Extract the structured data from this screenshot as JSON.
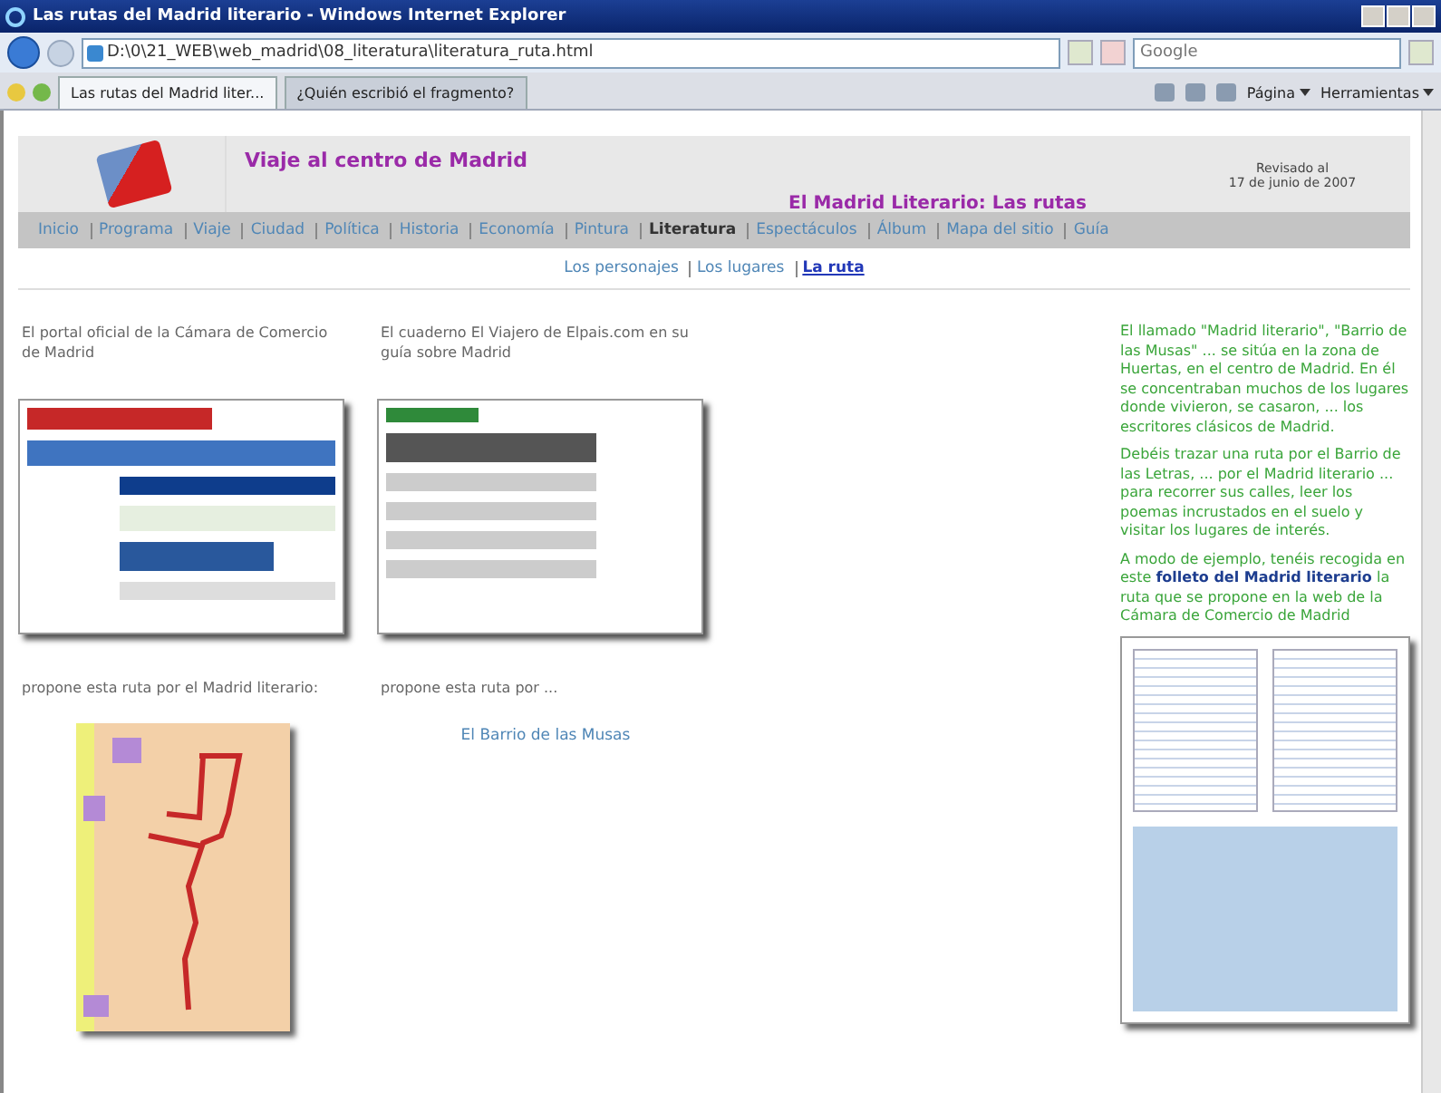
{
  "window": {
    "title": "Las rutas del Madrid literario - Windows Internet Explorer"
  },
  "address_bar": {
    "value": "D:\\0\\21_WEB\\web_madrid\\08_literatura\\literatura_ruta.html"
  },
  "search": {
    "placeholder": "Google"
  },
  "tabs": [
    {
      "label": "Las rutas del Madrid liter...",
      "selected": true
    },
    {
      "label": "¿Quién escribió el fragmento?",
      "selected": false
    }
  ],
  "toolbar": [
    "Página",
    "Herramientas"
  ],
  "page": {
    "title": "Viaje al centro de Madrid",
    "subtitle": "El Madrid Literario: Las rutas",
    "revised": [
      "Revisado al",
      "17 de junio de 2007"
    ],
    "nav": [
      {
        "label": "Inicio",
        "selected": false
      },
      {
        "label": "Programa",
        "selected": false
      },
      {
        "label": "Viaje",
        "selected": false
      },
      {
        "label": "Ciudad",
        "selected": false
      },
      {
        "label": "Política",
        "selected": false
      },
      {
        "label": "Historia",
        "selected": false
      },
      {
        "label": "Economía",
        "selected": false
      },
      {
        "label": "Pintura",
        "selected": false
      },
      {
        "label": "Literatura",
        "selected": true
      },
      {
        "label": "Espectáculos",
        "selected": false
      },
      {
        "label": "Álbum",
        "selected": false
      },
      {
        "label": "Mapa del sitio",
        "selected": false
      },
      {
        "label": "Guía",
        "selected": false
      }
    ],
    "subnav": [
      {
        "label": "Los personajes",
        "selected": false
      },
      {
        "label": "Los lugares",
        "selected": false
      },
      {
        "label": "La ruta",
        "selected": true
      }
    ],
    "columns": [
      {
        "caption": "El portal oficial de la Cámara de Comercio de Madrid",
        "note": "propone esta ruta por el Madrid literario:"
      },
      {
        "caption": "El cuaderno El Viajero de Elpais.com en su guía sobre Madrid",
        "note": "propone esta ruta por ...",
        "link": "El Barrio de las Musas"
      }
    ],
    "sidebar": [
      "El llamado \"Madrid literario\", \"Barrio de las Musas\" ... se sitúa en la zona de Huertas, en el centro de Madrid. En él se concentraban muchos de los lugares donde vivieron, se casaron, ... los escritores clásicos de Madrid.",
      "Debéis trazar una ruta por el Barrio de las Letras, ... por el Madrid literario ... para recorrer sus calles, leer los poemas incrustados en el suelo y visitar los lugares de interés.",
      "A modo de ejemplo, tenéis recogida en este **folleto del Madrid literario** la ruta que se propone en la web de la Cámara de Comercio de Madrid"
    ]
  }
}
